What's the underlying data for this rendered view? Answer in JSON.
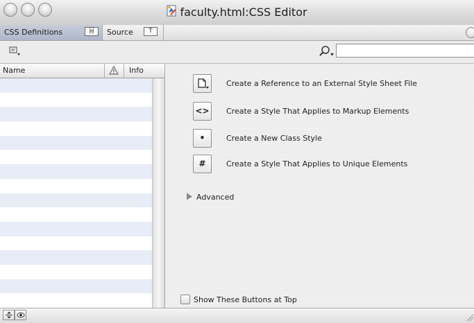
{
  "window": {
    "title": "faculty.html:CSS Editor",
    "title_icon": "html-document-icon"
  },
  "tabs": [
    {
      "label": "CSS Definitions",
      "glyph": "⌸",
      "selected": true
    },
    {
      "label": "Source",
      "glyph": "T",
      "selected": false
    }
  ],
  "toolbar": {
    "menu_icon": "sheet-menu-icon",
    "search_icon": "magnifier-menu-icon",
    "search_value": "",
    "search_placeholder": ""
  },
  "list": {
    "columns": {
      "name": "Name",
      "info": "Info"
    },
    "rows": []
  },
  "actions": [
    {
      "glyph": "",
      "icon": "document-icon",
      "label": "Create a Reference to an External Style Sheet File"
    },
    {
      "glyph": "<>",
      "icon": "markup-tag-icon",
      "label": "Create a Style That Applies to Markup Elements"
    },
    {
      "glyph": "•",
      "icon": "class-dot-icon",
      "label": "Create a New Class Style"
    },
    {
      "glyph": "#",
      "icon": "hash-icon",
      "label": "Create a Style That Applies to Unique Elements"
    }
  ],
  "advanced": {
    "label": "Advanced",
    "expanded": false
  },
  "options": {
    "show_buttons_top_label": "Show These Buttons at Top",
    "show_buttons_top_checked": false
  },
  "colors": {
    "list_stripe": "#e7ecf6",
    "selected_tab": "#b8bfd0",
    "window_bg": "#ececec"
  }
}
